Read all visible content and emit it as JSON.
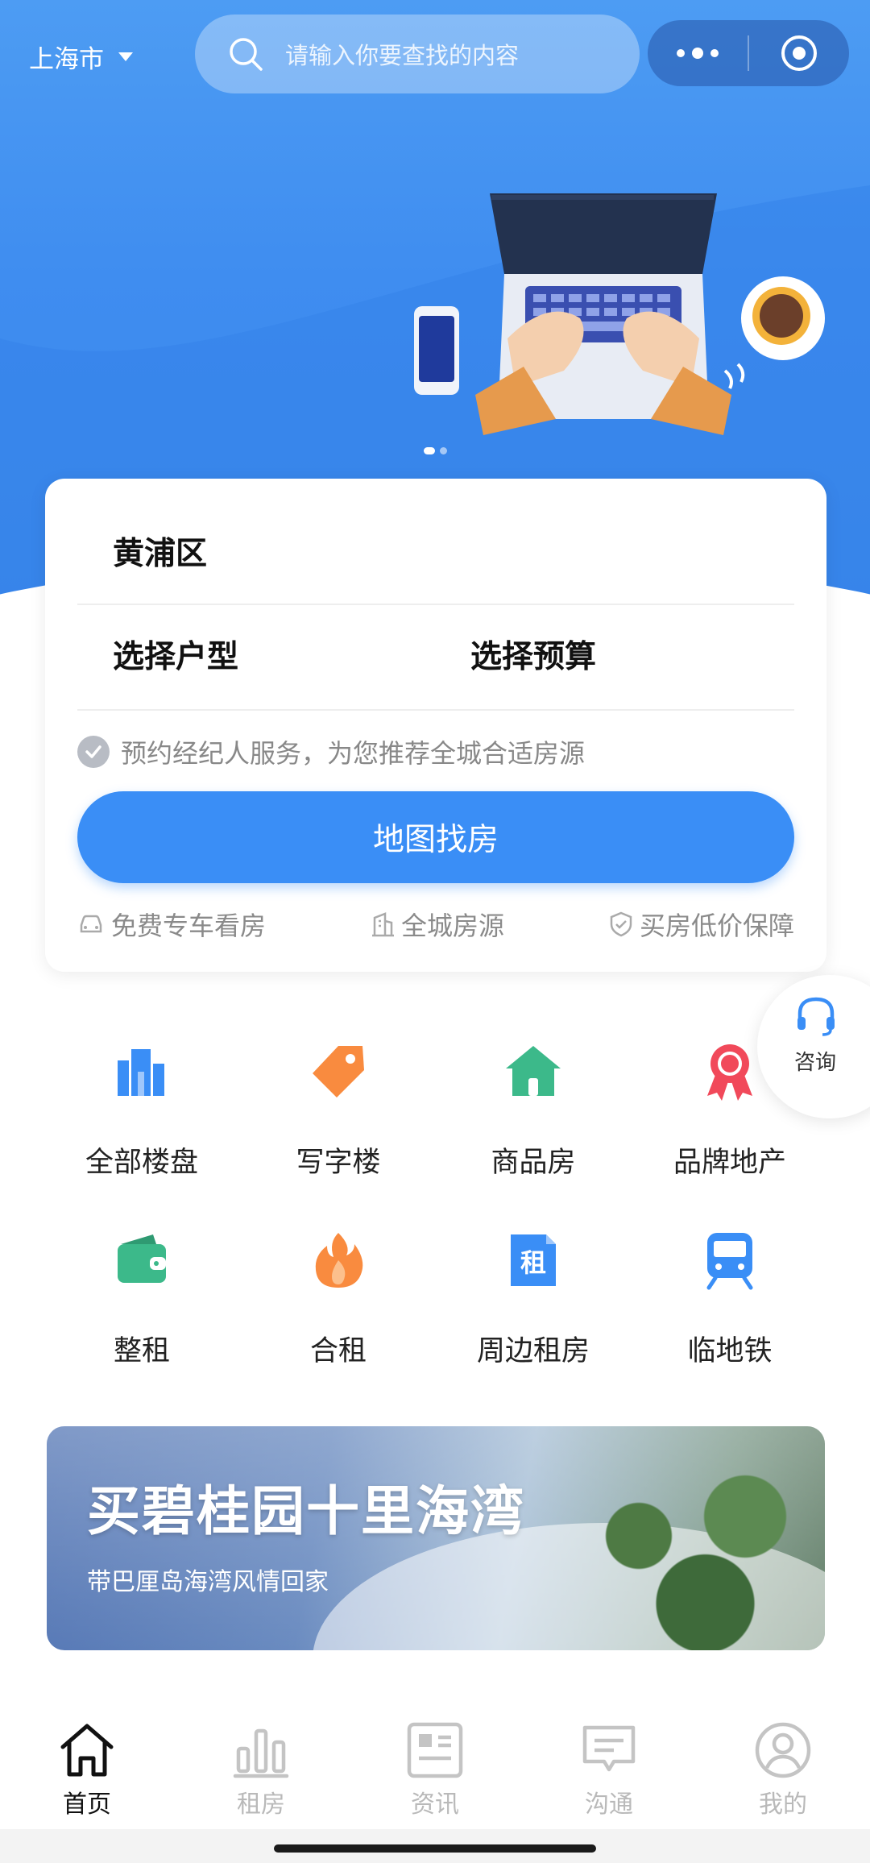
{
  "header": {
    "city": "上海市",
    "search_placeholder": "请输入你要查找的内容"
  },
  "search_card": {
    "district": "黄浦区",
    "house_type": "选择户型",
    "budget": "选择预算",
    "agent_note": "预约经纪人服务，为您推荐全城合适房源",
    "map_button": "地图找房",
    "features": [
      "免费专车看房",
      "全城房源",
      "买房低价保障"
    ]
  },
  "consult": {
    "label": "咨询"
  },
  "categories": [
    {
      "label": "全部楼盘",
      "icon": "buildings-icon",
      "color": "#3a8ef6"
    },
    {
      "label": "写字楼",
      "icon": "tag-icon",
      "color": "#f98b3f"
    },
    {
      "label": "商品房",
      "icon": "house-icon",
      "color": "#3cb98a"
    },
    {
      "label": "品牌地产",
      "icon": "award-icon",
      "color": "#f1495a"
    },
    {
      "label": "整租",
      "icon": "wallet-icon",
      "color": "#3cb98a"
    },
    {
      "label": "合租",
      "icon": "flame-icon",
      "color": "#f98b3f"
    },
    {
      "label": "周边租房",
      "icon": "rent-doc-icon",
      "color": "#3a8ef6"
    },
    {
      "label": "临地铁",
      "icon": "subway-icon",
      "color": "#3a8ef6"
    }
  ],
  "rent_icon_char": "租",
  "banner": {
    "title": "买碧桂园十里海湾",
    "subtitle": "带巴厘岛海湾风情回家"
  },
  "tabbar": [
    {
      "label": "首页",
      "icon": "home-icon",
      "active": true
    },
    {
      "label": "租房",
      "icon": "bar-chart-icon",
      "active": false
    },
    {
      "label": "资讯",
      "icon": "news-icon",
      "active": false
    },
    {
      "label": "沟通",
      "icon": "chat-icon",
      "active": false
    },
    {
      "label": "我的",
      "icon": "profile-icon",
      "active": false
    }
  ],
  "colors": {
    "primary": "#3a8ef6",
    "hero": "#3f8df0"
  }
}
